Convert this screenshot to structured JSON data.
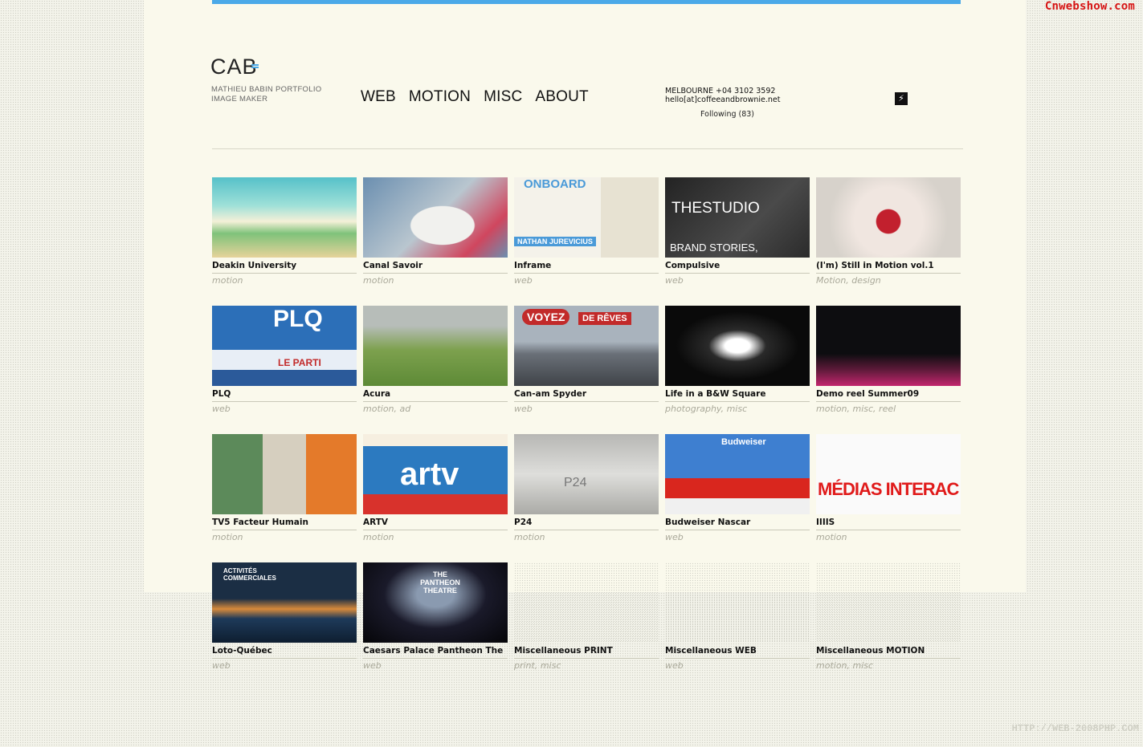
{
  "watermarks": {
    "top": "Cnwebshow.com",
    "bottom": "HTTP://WEB-2008PHP.COM"
  },
  "brand": {
    "logo": "CAB",
    "tagline_line1": "MATHIEU BABIN PORTFOLIO",
    "tagline_line2": "IMAGE MAKER"
  },
  "nav": [
    "WEB",
    "MOTION",
    "MISC",
    "ABOUT"
  ],
  "contact": {
    "phone": "MELBOURNE +04 3102 3592",
    "email": "hello[at]coffeeandbrownie.net",
    "following": "Following (83)"
  },
  "colors": {
    "accent": "#4aa9e8",
    "panel": "#faf9ec"
  },
  "items": [
    {
      "title": "Deakin University",
      "tags": "motion"
    },
    {
      "title": "Canal Savoir",
      "tags": "motion"
    },
    {
      "title": "Inframe",
      "tags": "web",
      "thumb_text": "ONBOARD",
      "thumb_sub": "NATHAN JUREVICIUS"
    },
    {
      "title": "Compulsive",
      "tags": "web",
      "thumb_text": "THESTUDIO",
      "thumb_sub": "BRAND STORIES,"
    },
    {
      "title": "(I'm) Still in Motion vol.1",
      "tags": "Motion, design"
    },
    {
      "title": "PLQ",
      "tags": "web",
      "thumb_text": "PLQ",
      "thumb_sub": "LE PARTI"
    },
    {
      "title": "Acura",
      "tags": "motion, ad"
    },
    {
      "title": "Can-am      Spyder",
      "tags": "web",
      "thumb_text": "VOYEZ",
      "thumb_sub": "DE RÊVES"
    },
    {
      "title": "Life in a B&W Square",
      "tags": "photography, misc"
    },
    {
      "title": "Demo reel Summer09",
      "tags": "motion, misc, reel"
    },
    {
      "title": "TV5      Facteur Humain",
      "tags": "motion"
    },
    {
      "title": "ARTV",
      "tags": "motion",
      "thumb_text": "artv"
    },
    {
      "title": "P24",
      "tags": "motion",
      "thumb_text": "P24"
    },
    {
      "title": "Budweiser      Nascar",
      "tags": "web",
      "thumb_text": "Budweiser"
    },
    {
      "title": "IIIIS",
      "tags": "motion",
      "thumb_text": "MÉDIAS INTERAC"
    },
    {
      "title": "Loto-Québec",
      "tags": "web",
      "thumb_text": "ACTIVITÉS COMMERCIALES"
    },
    {
      "title": "Caesars Palace      Pantheon The",
      "tags": "web",
      "thumb_text": "THE PANTHEON THEATRE"
    },
    {
      "title": "Miscellaneous PRINT",
      "tags": "print, misc"
    },
    {
      "title": "Miscellaneous WEB",
      "tags": "web"
    },
    {
      "title": "Miscellaneous MOTION",
      "tags": "motion, misc"
    }
  ]
}
